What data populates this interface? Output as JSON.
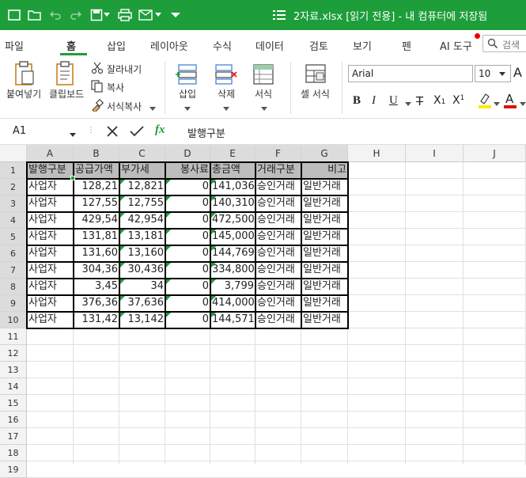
{
  "title_bar": {
    "title": "2자료.xlsx [읽기 전용] - 내 컴퓨터에 저장됨"
  },
  "menu": {
    "items": [
      "파일",
      "홈",
      "삽입",
      "레이아웃",
      "수식",
      "데이터",
      "검토",
      "보기",
      "펜",
      "AI 도구"
    ],
    "active": "홈",
    "search_placeholder": "검색"
  },
  "ribbon": {
    "paste": "붙여넣기",
    "clipboard": "클립보드",
    "cut": "잘라내기",
    "copy": "복사",
    "format_painter": "서식복사",
    "insert": "삽입",
    "delete": "삭제",
    "format": "서식",
    "cell_style": "셀 서식",
    "font_name": "Arial",
    "font_size": "10",
    "accent_color": "#1e9e3a",
    "highlight_color": "#ffeb00",
    "font_color": "#e01010"
  },
  "formula_bar": {
    "cell_ref": "A1",
    "fx": "fx",
    "content": "발행구분"
  },
  "sheet": {
    "columns": [
      "A",
      "B",
      "C",
      "D",
      "E",
      "F",
      "G",
      "H",
      "I",
      "J"
    ],
    "rows": [
      "1",
      "2",
      "3",
      "4",
      "5",
      "6",
      "7",
      "8",
      "9",
      "10",
      "11",
      "12",
      "13",
      "14",
      "15",
      "16",
      "17",
      "18",
      "19"
    ],
    "header": [
      "발행구분",
      "공급가액",
      "부가세",
      "봉사료",
      "총금액",
      "거래구분",
      "비고"
    ],
    "data": [
      [
        "사업자",
        "128,21",
        "12,821",
        "0",
        "141,036",
        "승인거래",
        "일반거래"
      ],
      [
        "사업자",
        "127,55",
        "12,755",
        "0",
        "140,310",
        "승인거래",
        "일반거래"
      ],
      [
        "사업자",
        "429,54",
        "42,954",
        "0",
        "472,500",
        "승인거래",
        "일반거래"
      ],
      [
        "사업자",
        "131,81",
        "13,181",
        "0",
        "145,000",
        "승인거래",
        "일반거래"
      ],
      [
        "사업자",
        "131,60",
        "13,160",
        "0",
        "144,769",
        "승인거래",
        "일반거래"
      ],
      [
        "사업자",
        "304,36",
        "30,436",
        "0",
        "334,800",
        "승인거래",
        "일반거래"
      ],
      [
        "사업자",
        "3,45",
        "34",
        "0",
        "3,799",
        "승인거래",
        "일반거래"
      ],
      [
        "사업자",
        "376,36",
        "37,636",
        "0",
        "414,000",
        "승인거래",
        "일반거래"
      ],
      [
        "사업자",
        "131,42",
        "13,142",
        "0",
        "144,571",
        "승인거래",
        "일반거래"
      ]
    ]
  }
}
